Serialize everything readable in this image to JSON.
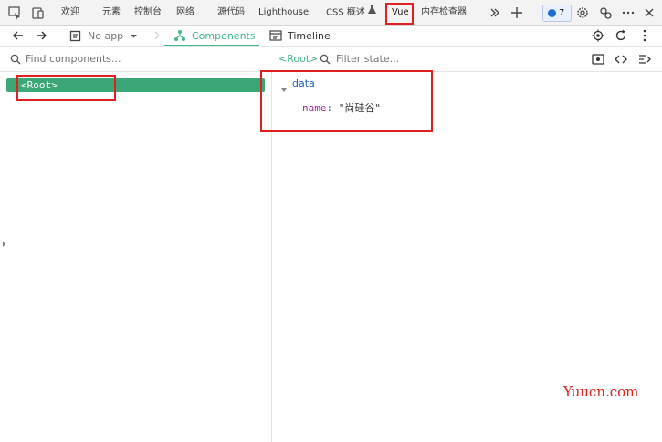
{
  "devtools": {
    "tabs": [
      {
        "label": "欢迎"
      },
      {
        "label": "元素"
      },
      {
        "label": "控制台"
      },
      {
        "label": "网络"
      },
      {
        "label": "源代码"
      },
      {
        "label": "Lighthouse"
      },
      {
        "label": "CSS 概述"
      },
      {
        "label": "Vue"
      },
      {
        "label": "内存检查器"
      }
    ],
    "issues_count": "7",
    "icons": [
      "inspect-icon",
      "device-toggle-icon",
      "more-tabs-icon",
      "add-tab-icon",
      "issues-icon",
      "settings-icon",
      "customize-icon",
      "more-options-icon",
      "close-icon",
      "flask-icon"
    ]
  },
  "vue_toolbar": {
    "app_select": "No app",
    "components_tab": "Components",
    "timeline_tab": "Timeline",
    "accent": "#42b883"
  },
  "components_search": {
    "placeholder": "Find components..."
  },
  "state_panel": {
    "breadcrumb": "<Root>",
    "filter_placeholder": "Filter state...",
    "section": "data",
    "field_key": "name",
    "field_sep": ":",
    "field_value": "\"尚硅谷\""
  },
  "tree": {
    "root_label": "<Root>"
  },
  "watermark": "Yuucn.com"
}
